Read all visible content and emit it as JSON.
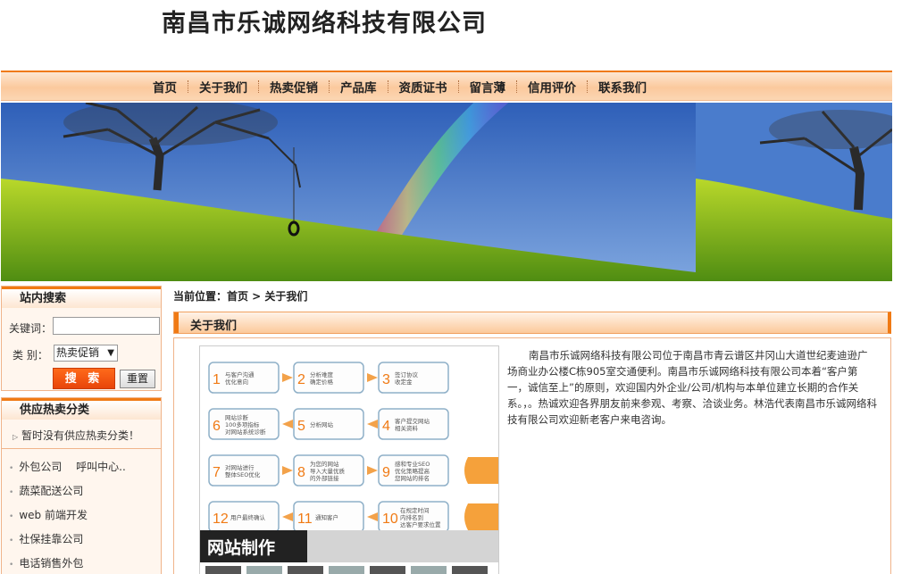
{
  "header": {
    "company_name": "南昌市乐诚网络科技有限公司"
  },
  "nav": {
    "items": [
      "首页",
      "关于我们",
      "热卖促销",
      "产品库",
      "资质证书",
      "留言薄",
      "信用评价",
      "联系我们"
    ]
  },
  "search": {
    "title": "站内搜索",
    "keyword_label": "关键词：",
    "category_label": "类 别：",
    "category_selected": "热卖促销",
    "search_button": "搜 索",
    "reset_button": "重置"
  },
  "categories": {
    "title": "供应热卖分类",
    "empty_text": "暂时没有供应热卖分类！",
    "links": [
      "外包公司　 呼叫中心..",
      "蔬菜配送公司",
      "web 前端开发",
      "社保挂靠公司",
      "电话销售外包"
    ]
  },
  "breadcrumb": {
    "text": "当前位置：首页 > 关于我们"
  },
  "section": {
    "title": "关于我们"
  },
  "about": {
    "text": "南昌市乐诚网络科技有限公司位于南昌市青云谱区井冈山大道世纪麦迪逊广场商业办公楼C栋905室交通便利。南昌市乐诚网络科技有限公司本着“客户第一，诚信至上”的原则，欢迎国内外企业/公司/机构与本单位建立长期的合作关系。，。热诚欢迎各界朋友前来参观、考察、洽谈业务。林浩代表南昌市乐诚网络科技有限公司欢迎新老客户来电咨询。",
    "image_caption": "网站制作",
    "flow_steps": [
      {
        "n": "1",
        "t": "与客户沟通\n优化意向"
      },
      {
        "n": "2",
        "t": "分析难度\n确定价格"
      },
      {
        "n": "3",
        "t": "签订协议\n收定金"
      },
      {
        "n": "4",
        "t": "客户提交网站\n相关资料"
      },
      {
        "n": "5",
        "t": "分析网站"
      },
      {
        "n": "6",
        "t": "网站诊断\n100多项指标\n对网站系统诊断"
      },
      {
        "n": "7",
        "t": "对网站进行\n整体SEO优化"
      },
      {
        "n": "8",
        "t": "为您的网站\n导入大量优质\n的外部链接"
      },
      {
        "n": "9",
        "t": "感和专业SEO\n优化策略提高\n您网站的排名"
      },
      {
        "n": "10",
        "t": "在规定时间\n内排名到\n达客户要求位置"
      },
      {
        "n": "11",
        "t": "通知客户"
      },
      {
        "n": "12",
        "t": "用户最终确认"
      }
    ]
  },
  "colors": {
    "accent": "#f07a14",
    "nav_bg": "#fbc99d",
    "button": "#ff6a1a"
  }
}
